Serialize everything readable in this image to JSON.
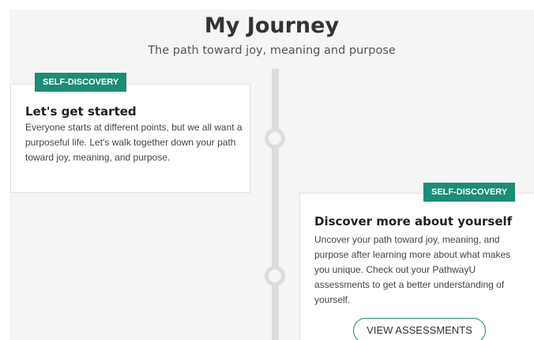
{
  "header": {
    "title": "My Journey",
    "subtitle": "The path toward joy, meaning and purpose"
  },
  "cards": [
    {
      "badge": "SELF-DISCOVERY",
      "title": "Let's get started",
      "text": "Everyone starts at different points, but we all want a purposeful life. Let's walk together down your path toward joy, meaning, and purpose."
    },
    {
      "badge": "SELF-DISCOVERY",
      "title": "Discover more about yourself",
      "text": "Uncover your path toward joy, meaning, and purpose after learning more about what makes you unique. Check out your PathwayU assessments to get a better understanding of yourself.",
      "button_label": "VIEW ASSESSMENTS"
    }
  ],
  "colors": {
    "accent": "#1d8c76",
    "timeline": "#dddddd",
    "background": "#f5f5f5"
  }
}
